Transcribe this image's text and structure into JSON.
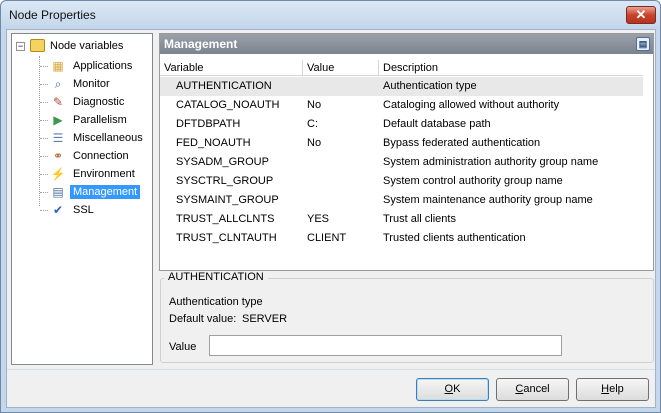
{
  "window": {
    "title": "Node Properties",
    "close_glyph": "✕"
  },
  "tree": {
    "root": {
      "label": "Node variables",
      "expander": "−",
      "icon": "folder-icon"
    },
    "items": [
      {
        "label": "Applications",
        "icon": "applications-icon",
        "glyph": "▦",
        "color": "#d9a63a"
      },
      {
        "label": "Monitor",
        "icon": "monitor-magnifier-icon",
        "glyph": "⌕",
        "color": "#3c6fb0"
      },
      {
        "label": "Diagnostic",
        "icon": "diagnostic-icon",
        "glyph": "✎",
        "color": "#b0453c"
      },
      {
        "label": "Parallelism",
        "icon": "parallelism-icon",
        "glyph": "▶",
        "color": "#3a9a4a"
      },
      {
        "label": "Miscellaneous",
        "icon": "miscellaneous-icon",
        "glyph": "☰",
        "color": "#5a7fb0"
      },
      {
        "label": "Connection",
        "icon": "connection-icon",
        "glyph": "⚭",
        "color": "#c0602a"
      },
      {
        "label": "Environment",
        "icon": "environment-icon",
        "glyph": "⚡",
        "color": "#d8a400"
      },
      {
        "label": "Management",
        "icon": "management-icon",
        "glyph": "▤",
        "color": "#4a6f9a"
      },
      {
        "label": "SSL",
        "icon": "ssl-icon",
        "glyph": "✔",
        "color": "#2a64b0"
      }
    ],
    "selected": "Management"
  },
  "panel": {
    "title": "Management",
    "header_icon": "properties-icon",
    "columns": [
      "Variable",
      "Value",
      "Description"
    ],
    "rows": [
      {
        "variable": "AUTHENTICATION",
        "value": "",
        "description": "Authentication type"
      },
      {
        "variable": "CATALOG_NOAUTH",
        "value": "No",
        "description": "Cataloging allowed without authority"
      },
      {
        "variable": "DFTDBPATH",
        "value": "C:",
        "description": "Default database path"
      },
      {
        "variable": "FED_NOAUTH",
        "value": "No",
        "description": "Bypass federated authentication"
      },
      {
        "variable": "SYSADM_GROUP",
        "value": "",
        "description": "System administration authority group name"
      },
      {
        "variable": "SYSCTRL_GROUP",
        "value": "",
        "description": "System control authority group name"
      },
      {
        "variable": "SYSMAINT_GROUP",
        "value": "",
        "description": "System maintenance authority group name"
      },
      {
        "variable": "TRUST_ALLCLNTS",
        "value": "YES",
        "description": "Trust all clients"
      },
      {
        "variable": "TRUST_CLNTAUTH",
        "value": "CLIENT",
        "description": "Trusted clients authentication"
      }
    ],
    "selected_row": "AUTHENTICATION"
  },
  "details": {
    "group_title": "AUTHENTICATION",
    "description": "Authentication type",
    "default_label": "Default value:",
    "default_value": "SERVER",
    "value_label": "Value",
    "value_input": ""
  },
  "buttons": {
    "ok": {
      "pre": "",
      "accel": "O",
      "post": "K"
    },
    "cancel": {
      "pre": "",
      "accel": "C",
      "post": "ancel"
    },
    "help": {
      "pre": "",
      "accel": "H",
      "post": "elp"
    }
  }
}
